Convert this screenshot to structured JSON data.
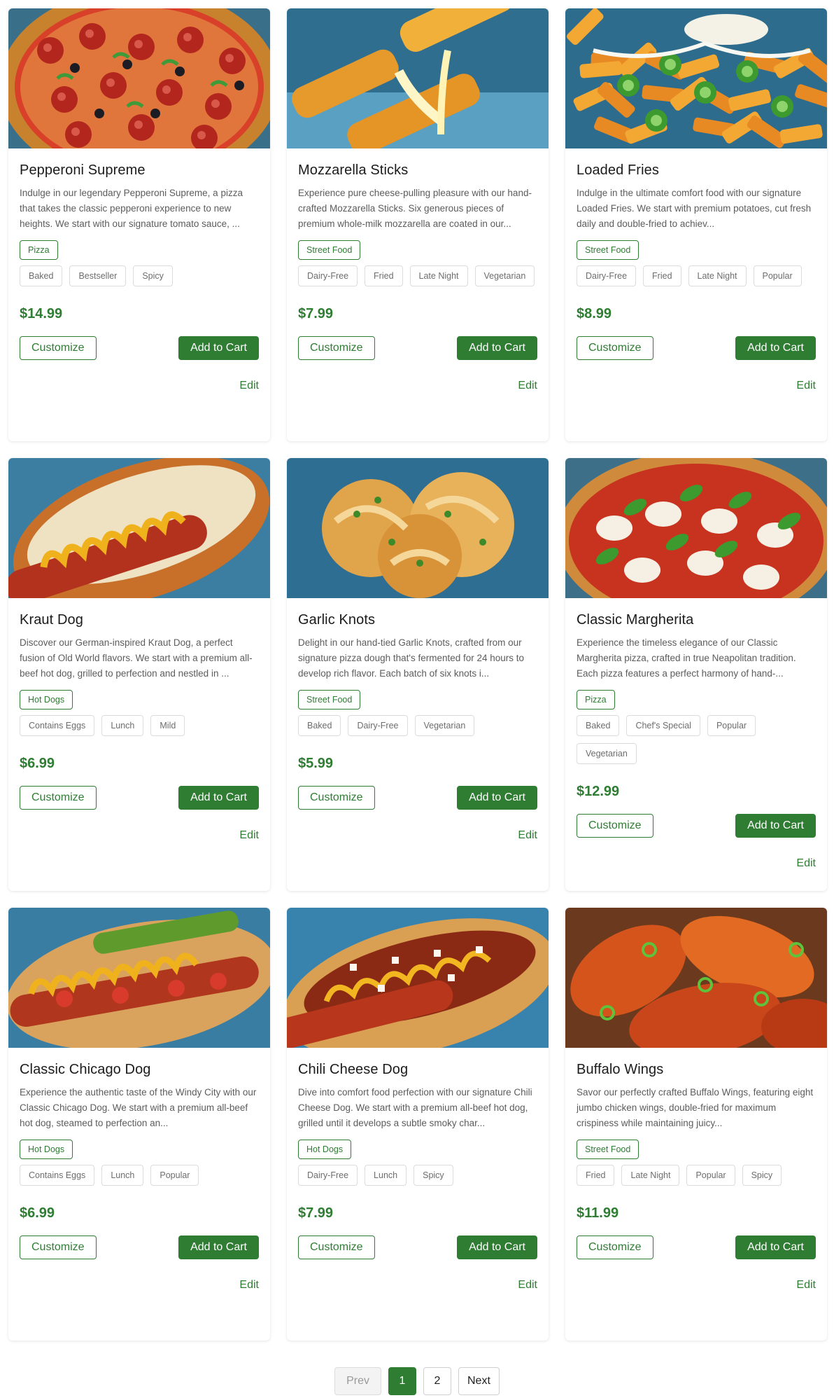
{
  "colors": {
    "accent": "#2e7d32",
    "muted_text": "#5c5c5c",
    "tag_border": "#dcdcdc"
  },
  "buttons": {
    "customize": "Customize",
    "add_to_cart": "Add to Cart",
    "edit": "Edit"
  },
  "products": [
    {
      "name": "Pepperoni Supreme",
      "description": "Indulge in our legendary Pepperoni Supreme, a pizza that takes the classic pepperoni experience to new heights. We start with our signature tomato sauce, ...",
      "category": "Pizza",
      "tags": [
        "Baked",
        "Bestseller",
        "Spicy"
      ],
      "price": "$14.99",
      "image": "pizza-pepperoni-image"
    },
    {
      "name": "Mozzarella Sticks",
      "description": "Experience pure cheese-pulling pleasure with our hand-crafted Mozzarella Sticks. Six generous pieces of premium whole-milk mozzarella are coated in our...",
      "category": "Street Food",
      "tags": [
        "Dairy-Free",
        "Fried",
        "Late Night",
        "Vegetarian"
      ],
      "price": "$7.99",
      "image": "mozzarella-sticks-image"
    },
    {
      "name": "Loaded Fries",
      "description": "Indulge in the ultimate comfort food with our signature Loaded Fries. We start with premium potatoes, cut fresh daily and double-fried to achiev...",
      "category": "Street Food",
      "tags": [
        "Dairy-Free",
        "Fried",
        "Late Night",
        "Popular"
      ],
      "price": "$8.99",
      "image": "loaded-fries-image"
    },
    {
      "name": "Kraut Dog",
      "description": "Discover our German-inspired Kraut Dog, a perfect fusion of Old World flavors. We start with a premium all-beef hot dog, grilled to perfection and nestled in ...",
      "category": "Hot Dogs",
      "tags": [
        "Contains Eggs",
        "Lunch",
        "Mild"
      ],
      "price": "$6.99",
      "image": "kraut-dog-image"
    },
    {
      "name": "Garlic Knots",
      "description": "Delight in our hand-tied Garlic Knots, crafted from our signature pizza dough that's fermented for 24 hours to develop rich flavor. Each batch of six knots i...",
      "category": "Street Food",
      "tags": [
        "Baked",
        "Dairy-Free",
        "Vegetarian"
      ],
      "price": "$5.99",
      "image": "garlic-knots-image"
    },
    {
      "name": "Classic Margherita",
      "description": "Experience the timeless elegance of our Classic Margherita pizza, crafted in true Neapolitan tradition. Each pizza features a perfect harmony of hand-...",
      "category": "Pizza",
      "tags": [
        "Baked",
        "Chef's Special",
        "Popular",
        "Vegetarian"
      ],
      "price": "$12.99",
      "image": "margherita-image"
    },
    {
      "name": "Classic Chicago Dog",
      "description": "Experience the authentic taste of the Windy City with our Classic Chicago Dog. We start with a premium all-beef hot dog, steamed to perfection an...",
      "category": "Hot Dogs",
      "tags": [
        "Contains Eggs",
        "Lunch",
        "Popular"
      ],
      "price": "$6.99",
      "image": "chicago-dog-image"
    },
    {
      "name": "Chili Cheese Dog",
      "description": "Dive into comfort food perfection with our signature Chili Cheese Dog. We start with a premium all-beef hot dog, grilled until it develops a subtle smoky char...",
      "category": "Hot Dogs",
      "tags": [
        "Dairy-Free",
        "Lunch",
        "Spicy"
      ],
      "price": "$7.99",
      "image": "chili-cheese-dog-image"
    },
    {
      "name": "Buffalo Wings",
      "description": "Savor our perfectly crafted Buffalo Wings, featuring eight jumbo chicken wings, double-fried for maximum crispiness while maintaining juicy...",
      "category": "Street Food",
      "tags": [
        "Fried",
        "Late Night",
        "Popular",
        "Spicy"
      ],
      "price": "$11.99",
      "image": "buffalo-wings-image"
    }
  ],
  "pagination": {
    "prev": "Prev",
    "pages": [
      "1",
      "2"
    ],
    "current": "1",
    "next": "Next"
  }
}
